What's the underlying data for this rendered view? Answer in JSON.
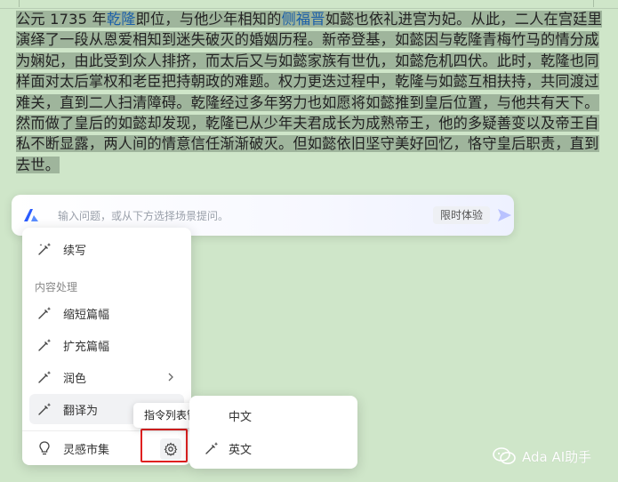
{
  "document": {
    "lines": [
      [
        {
          "text": "公元 1735 年",
          "link": false
        },
        {
          "text": "乾隆",
          "link": true
        },
        {
          "text": "即位，与他少年相知的",
          "link": false
        },
        {
          "text": "侧福晋",
          "link": true
        },
        {
          "text": "如懿也依礼进宫为妃。从此，二人在宫廷里",
          "link": false
        }
      ],
      [
        {
          "text": "演绎了一段从恩爱相知到迷失破灭的婚姻历程。新帝登基，如懿因与乾隆青梅竹马的情分成",
          "link": false
        }
      ],
      [
        {
          "text": "为娴妃，由此受到众人排挤，而太后又与如懿家族有世仇，如懿危机四伏。此时，乾隆也同",
          "link": false
        }
      ],
      [
        {
          "text": "样面对太后掌权和老臣把持朝政的难题。权力更迭过程中，乾隆与如懿互相扶持，共同渡过",
          "link": false
        }
      ],
      [
        {
          "text": "难关，直到二人扫清障碍。乾隆经过多年努力也如愿将如懿推到皇后位置，与他共有天下。",
          "link": false
        }
      ],
      [
        {
          "text": "然而做了皇后的如懿却发现，乾隆已从少年夫君成长为成熟帝王，他的多疑善变以及帝王自",
          "link": false
        }
      ],
      [
        {
          "text": "私不断显露，两人间的情意信任渐渐破灭。但如懿依旧坚守美好回忆，恪守皇后职责，直到",
          "link": false
        }
      ],
      [
        {
          "text": "去世。",
          "link": false
        }
      ]
    ]
  },
  "ai_bar": {
    "placeholder": "输入问题，或从下方选择场景提问。",
    "trial_badge": "限时体验",
    "logo_icon": "ai-logo-icon",
    "send_icon": "send-arrow-icon"
  },
  "menu": {
    "continue_writing": "续写",
    "section_title": "内容处理",
    "shorten": "缩短篇幅",
    "expand": "扩充篇幅",
    "polish": "润色",
    "translate": "翻译为",
    "inspiration": "灵感市集"
  },
  "tooltip": {
    "text": "指令列表管理"
  },
  "submenu": {
    "chinese": "中文",
    "english": "英文"
  },
  "watermark": {
    "text": "Ada AI助手"
  },
  "colors": {
    "background": "#cfe6c9",
    "selection": "#9fb59c",
    "link": "#1b5fa8",
    "highlight_border": "#e02020",
    "accent": "#7a8cff"
  }
}
